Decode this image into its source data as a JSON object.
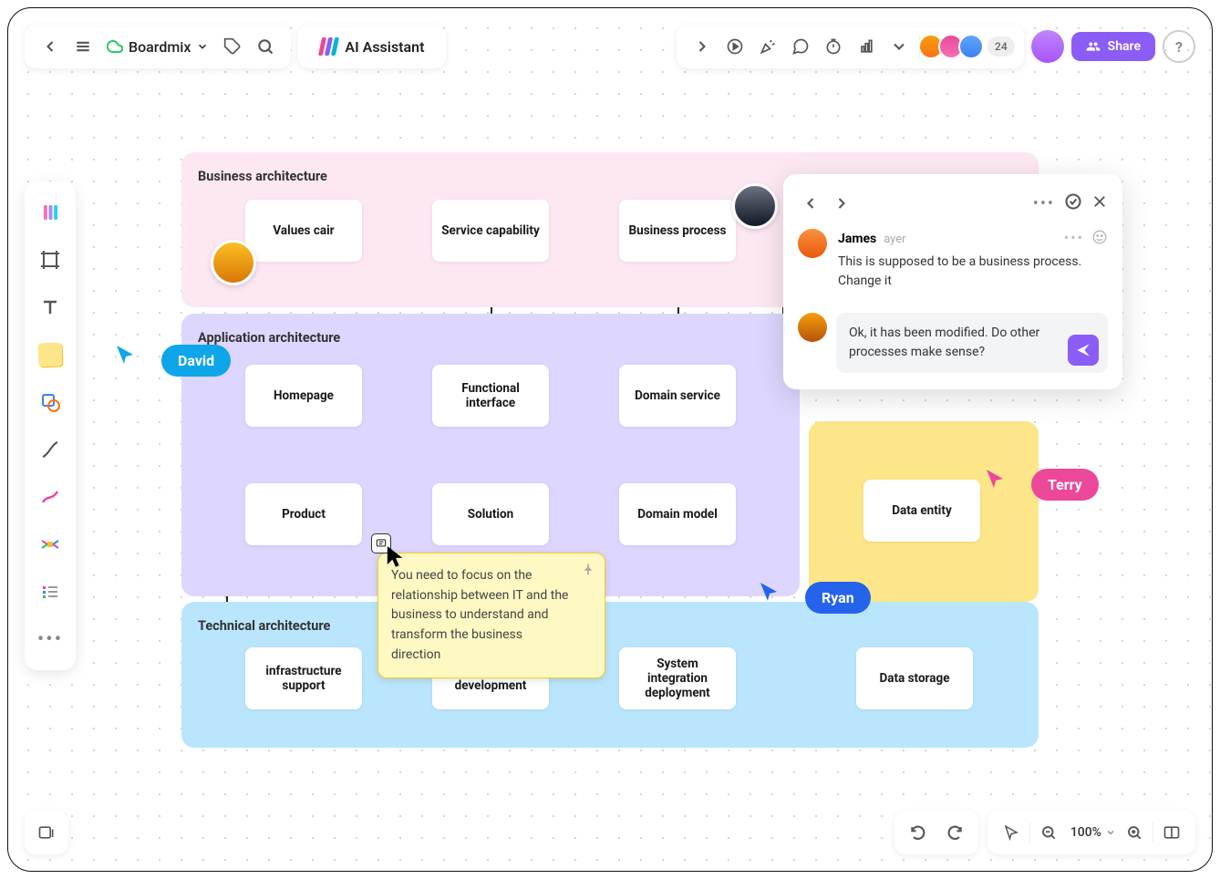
{
  "header": {
    "board_name": "Boardmix",
    "ai_label": "AI Assistant",
    "avatar_count": "24",
    "share_label": "Share"
  },
  "zoom": "100%",
  "cursors": {
    "david": "David",
    "ryan": "Ryan",
    "terry": "Terry"
  },
  "layers": {
    "business": {
      "title": "Business architecture",
      "nodes": {
        "values": "Values cair",
        "service_cap": "Service capability",
        "process": "Business process"
      }
    },
    "application": {
      "title": "Application architecture",
      "nodes": {
        "home": "Homepage",
        "func": "Functional interface",
        "domsvc": "Domain service",
        "product": "Product",
        "solution": "Solution",
        "dommodel": "Domain model"
      }
    },
    "data": {
      "nodes": {
        "entity": "Data entity"
      }
    },
    "technical": {
      "title": "Technical architecture",
      "nodes": {
        "infra": "infrastructure support",
        "svcdev": "service development",
        "sysint": "System integration deployment",
        "storage": "Data storage"
      }
    }
  },
  "note": {
    "text": "You need to focus on the relationship between IT and the business to understand and transform the business direction"
  },
  "comments": {
    "author": "James",
    "time": "ayer",
    "text": "This is supposed to be a business process. Change it",
    "reply": "Ok, it has been modified. Do other processes make sense?"
  }
}
